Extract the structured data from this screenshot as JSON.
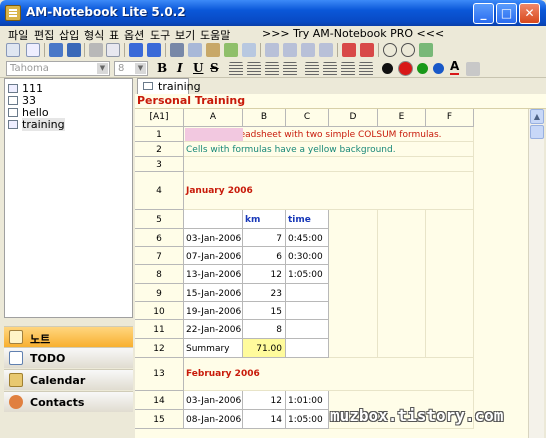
{
  "window": {
    "title": "AM-Notebook Lite  5.0.2"
  },
  "menu": {
    "items": [
      "파일",
      "편집",
      "삽입",
      "형식",
      "표",
      "옵션",
      "도구",
      "보기",
      "도움말"
    ],
    "promo": ">>> Try AM-Notebook PRO <<<"
  },
  "format_bar": {
    "font": "Tahoma",
    "size": "8",
    "bold": "B",
    "italic": "I",
    "underline": "U",
    "strike": "S",
    "font_color_glyph": "A"
  },
  "colors": {
    "red": "#d81818",
    "green": "#189818",
    "blue": "#1858c8",
    "black": "#101010"
  },
  "tree": {
    "items": [
      "111",
      "33",
      "hello",
      "training"
    ]
  },
  "nav": {
    "notes": "노트",
    "todo": "TODO",
    "calendar": "Calendar",
    "contacts": "Contacts"
  },
  "tab": {
    "label": "training"
  },
  "doc": {
    "title": "Personal Training"
  },
  "sheet": {
    "corner": "[A1]",
    "columns": [
      "A",
      "B",
      "C",
      "D",
      "E",
      "F"
    ],
    "rows": [
      {
        "n": "1",
        "text": "This is a spreadsheet with two simple COLSUM formulas."
      },
      {
        "n": "2",
        "text": "Cells with formulas have a yellow background."
      },
      {
        "n": "3",
        "text": ""
      },
      {
        "n": "4",
        "text": "January 2006"
      },
      {
        "n": "5",
        "a": "",
        "b": "km",
        "c": "time"
      },
      {
        "n": "6",
        "a": "03-Jan-2006",
        "b": "7",
        "c": "0:45:00"
      },
      {
        "n": "7",
        "a": "07-Jan-2006",
        "b": "6",
        "c": "0:30:00"
      },
      {
        "n": "8",
        "a": "13-Jan-2006",
        "b": "12",
        "c": "1:05:00"
      },
      {
        "n": "9",
        "a": "15-Jan-2006",
        "b": "23",
        "c": ""
      },
      {
        "n": "10",
        "a": "19-Jan-2006",
        "b": "15",
        "c": ""
      },
      {
        "n": "11",
        "a": "22-Jan-2006",
        "b": "8",
        "c": ""
      },
      {
        "n": "12",
        "a": "Summary",
        "b": "71.00",
        "c": ""
      },
      {
        "n": "13",
        "text": "February 2006"
      },
      {
        "n": "14",
        "a": "03-Jan-2006",
        "b": "12",
        "c": "1:01:00"
      },
      {
        "n": "15",
        "a": "08-Jan-2006",
        "b": "14",
        "c": "1:05:00"
      }
    ]
  },
  "watermark": "muzbox.tistory.com"
}
